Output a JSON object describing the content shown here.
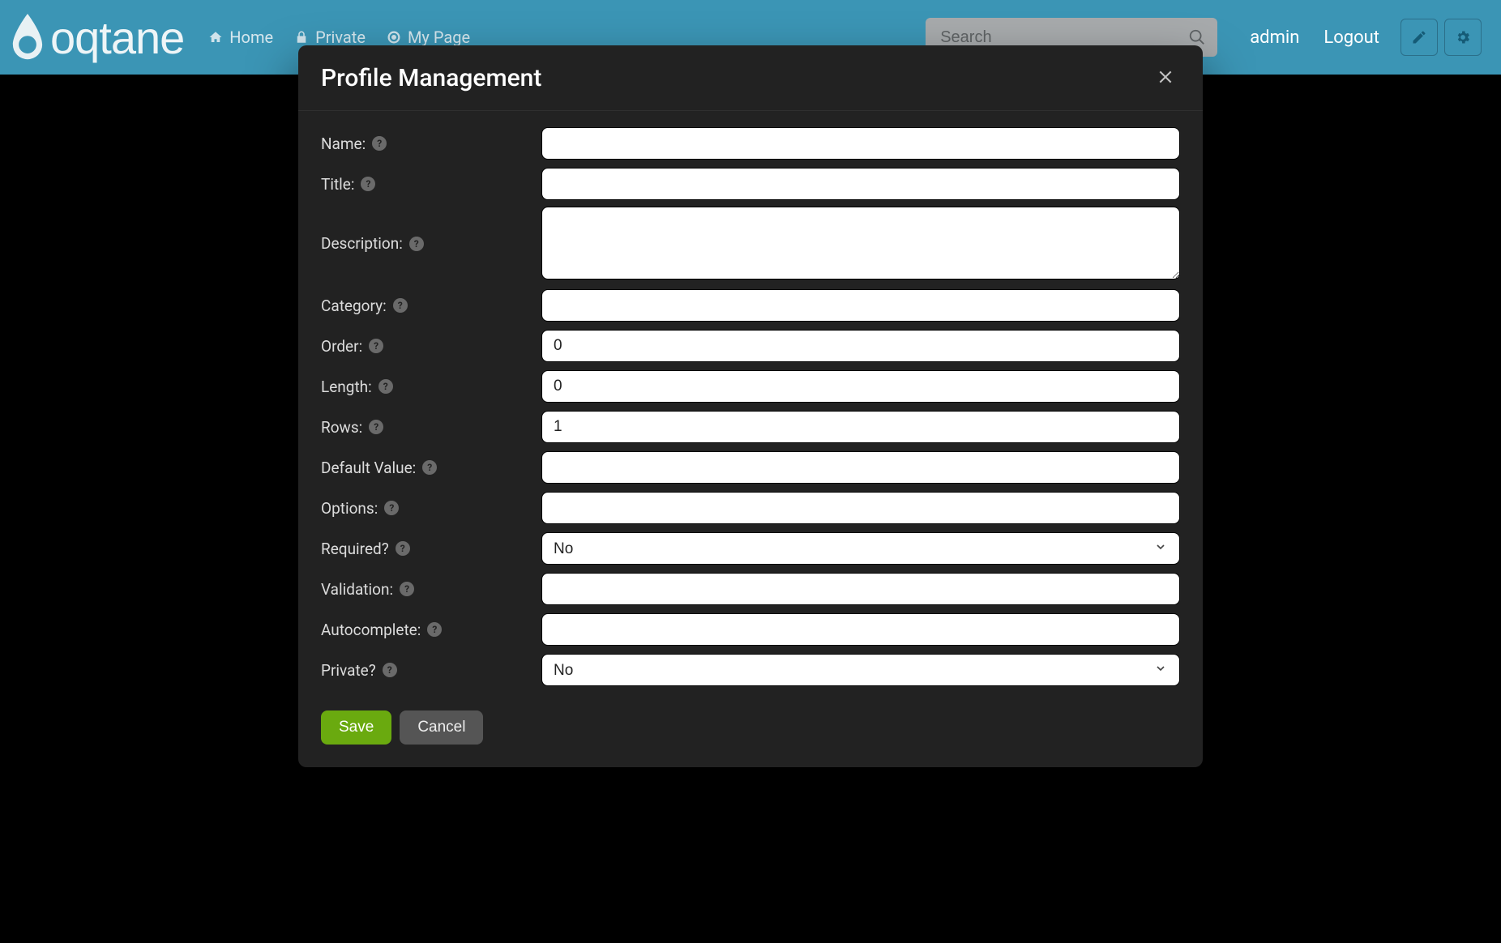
{
  "brand": "oqtane",
  "nav": [
    {
      "icon": "home-icon",
      "label": "Home"
    },
    {
      "icon": "lock-icon",
      "label": "Private"
    },
    {
      "icon": "target-icon",
      "label": "My Page"
    }
  ],
  "search": {
    "placeholder": "Search"
  },
  "user": {
    "name": "admin",
    "logout": "Logout"
  },
  "modal": {
    "title": "Profile Management",
    "save_label": "Save",
    "cancel_label": "Cancel",
    "fields": {
      "name": {
        "label": "Name:",
        "value": ""
      },
      "title": {
        "label": "Title:",
        "value": ""
      },
      "description": {
        "label": "Description:",
        "value": ""
      },
      "category": {
        "label": "Category:",
        "value": ""
      },
      "order": {
        "label": "Order:",
        "value": "0"
      },
      "length": {
        "label": "Length:",
        "value": "0"
      },
      "rows": {
        "label": "Rows:",
        "value": "1"
      },
      "default_value": {
        "label": "Default Value:",
        "value": ""
      },
      "options": {
        "label": "Options:",
        "value": ""
      },
      "required": {
        "label": "Required?",
        "value": "No"
      },
      "validation": {
        "label": "Validation:",
        "value": ""
      },
      "autocomplete": {
        "label": "Autocomplete:",
        "value": ""
      },
      "private": {
        "label": "Private?",
        "value": "No"
      }
    }
  }
}
